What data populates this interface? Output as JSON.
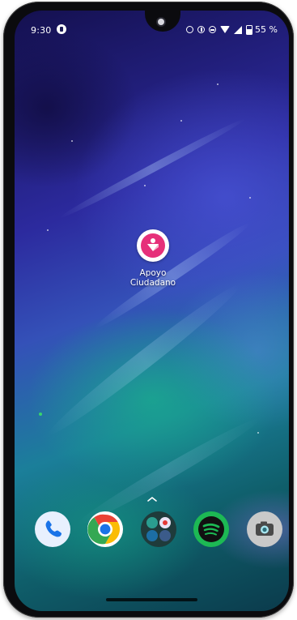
{
  "status_bar": {
    "time": "9:30",
    "battery_percent": "55 %",
    "notification_icon": "app-notification-icon",
    "right_icons": [
      "alarm-icon",
      "data-saver-icon",
      "do-not-disturb-icon",
      "wifi-icon",
      "signal-icon",
      "battery-icon"
    ]
  },
  "home_screen": {
    "app_shortcut": {
      "label": "Apoyo Ciudadano",
      "icon": "apoyo-ciudadano-icon",
      "accent_color": "#e6307a"
    },
    "dock": [
      {
        "name": "Phone",
        "icon": "phone-icon"
      },
      {
        "name": "Chrome",
        "icon": "chrome-icon"
      },
      {
        "name": "Folder",
        "icon": "folder-icon"
      },
      {
        "name": "Spotify",
        "icon": "spotify-icon"
      },
      {
        "name": "Camera",
        "icon": "camera-icon"
      }
    ]
  },
  "colors": {
    "wallpaper_top": "#14104f",
    "wallpaper_mid": "#2c2a9e",
    "wallpaper_bottom": "#0f5e6a",
    "aurora_green": "#19af8c",
    "phone_blue": "#1a73e8",
    "chrome_red": "#ea4335",
    "chrome_yellow": "#fbbc05",
    "chrome_green": "#34a853",
    "spotify_green": "#1db954"
  }
}
